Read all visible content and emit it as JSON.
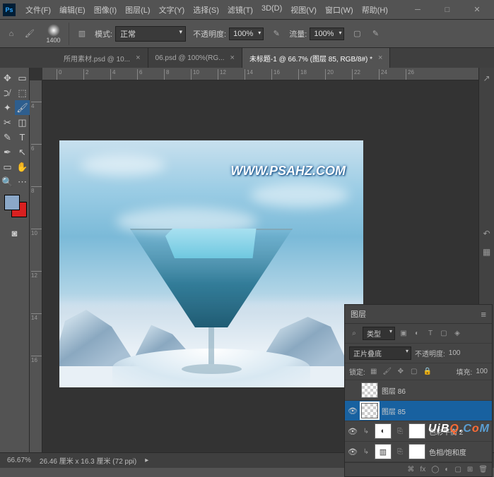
{
  "menu": [
    "文件(F)",
    "编辑(E)",
    "图像(I)",
    "图层(L)",
    "文字(Y)",
    "选择(S)",
    "滤镜(T)",
    "3D(D)",
    "视图(V)",
    "窗口(W)",
    "帮助(H)"
  ],
  "options": {
    "brush_size": "1400",
    "mode_label": "模式:",
    "mode_value": "正常",
    "opacity_label": "不透明度:",
    "opacity_value": "100%",
    "flow_label": "流量:",
    "flow_value": "100%"
  },
  "tabs": [
    {
      "title": "所用素材.psd @ 10...",
      "active": false
    },
    {
      "title": "06.psd @ 100%(RG...",
      "active": false
    },
    {
      "title": "未标题-1 @ 66.7% (图层 85, RGB/8#) *",
      "active": true
    }
  ],
  "ruler_top": [
    "0",
    "2",
    "4",
    "6",
    "8",
    "10",
    "12",
    "14",
    "16",
    "18",
    "20",
    "22",
    "24",
    "26"
  ],
  "ruler_left": [
    "4",
    "6",
    "8",
    "10",
    "12",
    "14",
    "16"
  ],
  "artwork": {
    "watermark": "WWW.PSAHZ.COM"
  },
  "colors": {
    "fg": "#8ba8c8",
    "bg": "#d92020"
  },
  "layers_panel": {
    "title": "图层",
    "type_label": "类型",
    "blend_mode": "正片叠底",
    "opacity_label": "不透明度:",
    "opacity_value": "100",
    "lock_label": "锁定:",
    "fill_label": "填充:",
    "fill_value": "100",
    "layers": [
      {
        "name": "图层 86",
        "visible": false,
        "active": false,
        "kind": "pixel"
      },
      {
        "name": "图层 85",
        "visible": true,
        "active": true,
        "kind": "pixel"
      },
      {
        "name": "色彩平衡 2",
        "visible": true,
        "active": false,
        "kind": "adj"
      },
      {
        "name": "色相/饱和度",
        "visible": true,
        "active": false,
        "kind": "adj"
      }
    ]
  },
  "status": {
    "zoom": "66.67%",
    "dims": "26.46 厘米 x 16.3 厘米 (72 ppi)"
  },
  "logo": {
    "t1": "UiB",
    "t2": "Q",
    "t3": ".",
    "t4": "C",
    "t5": "o",
    "t6": "M"
  }
}
